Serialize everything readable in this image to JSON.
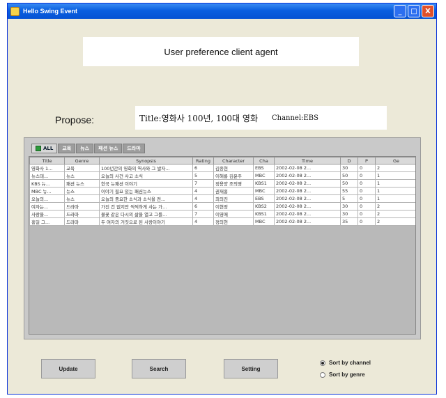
{
  "window": {
    "title": "Hello Swing Event",
    "minimize": "_",
    "maximize": "□",
    "close": "X"
  },
  "header": {
    "text": "User preference client agent"
  },
  "propose": {
    "label": "Propose:",
    "title": "Title:영화사 100년, 100대 영화",
    "channel": "Channel:EBS"
  },
  "tabs": [
    {
      "label": "ALL",
      "active": true
    },
    {
      "label": "교육"
    },
    {
      "label": "뉴스"
    },
    {
      "label": "패션 뉴스"
    },
    {
      "label": "드라마"
    }
  ],
  "table": {
    "columns": [
      "Title",
      "Genre",
      "Synopsis",
      "Rating",
      "Character",
      "Cha",
      "Time",
      "D",
      "P",
      "Ge"
    ],
    "rows": [
      [
        "영화사 1...",
        "교육",
        "100년간의 영화의 역사와 그 발자...",
        "6",
        "김종현",
        "EBS",
        "2002-02-08 2...",
        "30",
        "0",
        "2"
      ],
      [
        "뉴스데...",
        "뉴스",
        "오늘의 사건 사고 소식",
        "5",
        "이해룡 김윤주",
        "MBC",
        "2002-02-08 2...",
        "50",
        "0",
        "1"
      ],
      [
        "KBS 뉴...",
        "패션 뉴스",
        "한국 뉴패션 이야기",
        "7",
        "정용양 조의영",
        "KBS1",
        "2002-02-08 2...",
        "50",
        "0",
        "1"
      ],
      [
        "MBC 뉴...",
        "뉴스",
        "이야기 필요 있는 패션뉴스",
        "4",
        "권재홍",
        "MBC",
        "2002-02-08 2...",
        "55",
        "0",
        "1"
      ],
      [
        "오늘의...",
        "뉴스",
        "오늘의 중요한 소식과 소식을 전...",
        "4",
        "최의진",
        "EBS",
        "2002-02-08 2...",
        "5",
        "0",
        "1"
      ],
      [
        "여자는...",
        "드라마",
        "가진 건 없지만 씩씩하게 사는 가...",
        "6",
        "이현정",
        "KBS2",
        "2002-02-08 2...",
        "30",
        "0",
        "2"
      ],
      [
        "사랑을...",
        "드라마",
        "불꽃 같은 다시의 삶을 열고 그를...",
        "7",
        "이영애",
        "KBS1",
        "2002-02-08 2...",
        "30",
        "0",
        "2"
      ],
      [
        "홍일 그...",
        "드라마",
        "두 여자의 거짓으로 된 사랑이야기",
        "4",
        "정의현",
        "MBC",
        "2002-02-08 2...",
        "35",
        "0",
        "2"
      ]
    ]
  },
  "buttons": {
    "update": "Update",
    "search": "Search",
    "setting": "Setting"
  },
  "sort": {
    "by_channel": "Sort by channel",
    "by_genre": "Sort by genre",
    "selected": "by_channel"
  }
}
